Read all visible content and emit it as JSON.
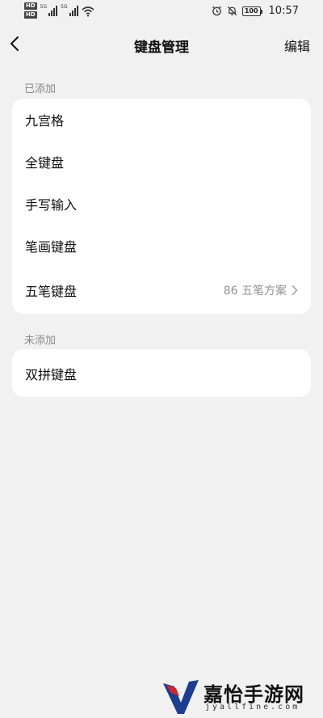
{
  "status_bar": {
    "hd_1": "HD",
    "hd_2": "HD",
    "network": "5G",
    "battery": "100",
    "time": "10:57",
    "icons": [
      "hd-icon",
      "signal-icon",
      "wifi-icon",
      "alarm-icon",
      "mute-icon",
      "battery-icon"
    ]
  },
  "header": {
    "title": "键盘管理",
    "edit_label": "编辑"
  },
  "added": {
    "label": "已添加",
    "items": [
      {
        "label": "九宫格",
        "value": ""
      },
      {
        "label": "全键盘",
        "value": ""
      },
      {
        "label": "手写输入",
        "value": ""
      },
      {
        "label": "笔画键盘",
        "value": ""
      },
      {
        "label": "五笔键盘",
        "value": "86 五笔方案"
      }
    ]
  },
  "not_added": {
    "label": "未添加",
    "items": [
      {
        "label": "双拼键盘"
      }
    ]
  },
  "watermark": {
    "name": "嘉怡手游网",
    "url": "jyallfine.com"
  },
  "colors": {
    "background": "#f1f1f1",
    "card": "#ffffff",
    "secondary_text": "#8f8f8f",
    "logo_blue": "#1d3d8f",
    "logo_red": "#d0262d"
  }
}
